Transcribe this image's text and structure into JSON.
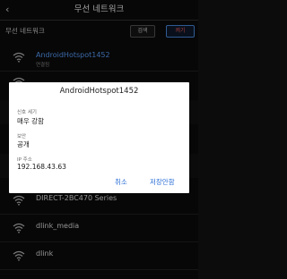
{
  "header": {
    "title": "무선 네트워크",
    "back_icon": "back-arrow-icon"
  },
  "subheader": {
    "label": "무선 네트워크",
    "search_button": "검색",
    "toggle_button": "켜기"
  },
  "networks": [
    {
      "name": "AndroidHotspot1452",
      "status": "연결됨",
      "highlight": true
    },
    {
      "name": "",
      "status": ""
    },
    {
      "name": "",
      "status": ""
    },
    {
      "name": "",
      "status": ""
    },
    {
      "name": "",
      "status": ""
    },
    {
      "name": "DIRECT-2BC470 Series",
      "status": ""
    },
    {
      "name": "dlink_media",
      "status": ""
    },
    {
      "name": "dlink",
      "status": ""
    }
  ],
  "dialog": {
    "title": "AndroidHotspot1452",
    "signal_label": "신호 세기",
    "signal_value": "매우 강함",
    "security_label": "보안",
    "security_value": "공개",
    "ip_label": "IP 주소",
    "ip_value": "192.168.43.63",
    "cancel": "취소",
    "disconnect": "저장안함"
  },
  "colors": {
    "accent": "#2b6fd6",
    "highlight": "#5aa0ff",
    "toggle_text": "#ff5d5d"
  }
}
